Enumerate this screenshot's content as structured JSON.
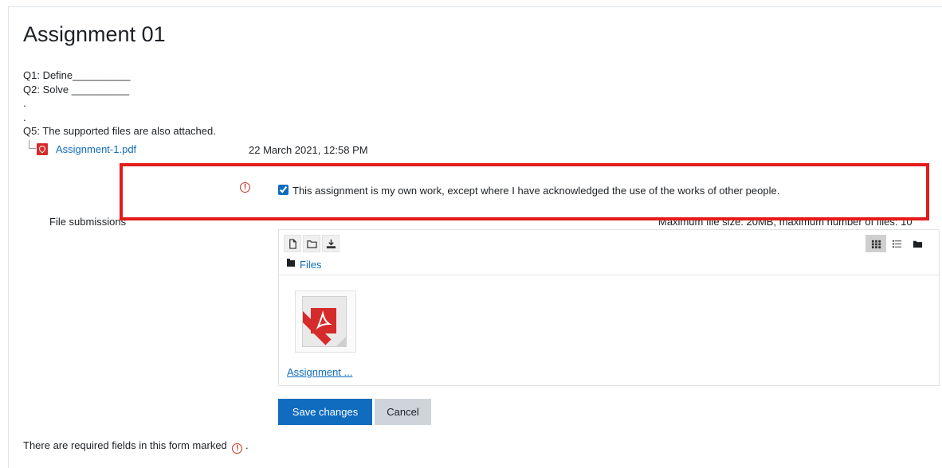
{
  "page": {
    "title": "Assignment 01",
    "intro_lines": [
      "Q1: Define__________",
      "Q2: Solve __________",
      ".",
      ".",
      "Q5: The supported files are also attached."
    ],
    "attachment": {
      "name": "Assignment-1.pdf",
      "date": "22 March 2021, 12:58 PM"
    }
  },
  "form": {
    "declaration_text": "This assignment is my own work, except where I have acknowledged the use of the works of other people.",
    "declaration_checked": true,
    "file_submissions_label": "File submissions",
    "max_info": "Maximum file size: 20MB, maximum number of files: 10",
    "file_manager": {
      "path_label": "Files",
      "files": [
        {
          "name": "Assignment ..."
        }
      ],
      "toolbar_icons": [
        "add-file-icon",
        "create-folder-icon",
        "download-icon"
      ],
      "view_icons": [
        "grid-view-icon",
        "list-view-icon",
        "tree-view-icon"
      ]
    },
    "save_label": "Save changes",
    "cancel_label": "Cancel",
    "required_note": "There are required fields in this form marked",
    "required_note_suffix": "."
  },
  "colors": {
    "accent": "#0f6cbf",
    "required": "#ca3120",
    "highlight": "#e41b1b",
    "pdf": "#d62b2b"
  }
}
